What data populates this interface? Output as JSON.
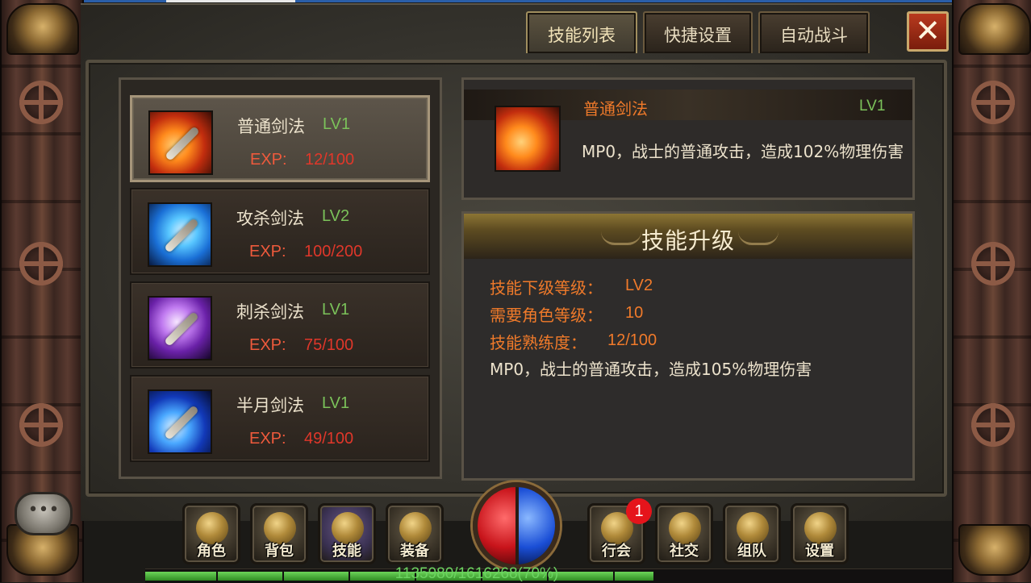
{
  "tabs": [
    {
      "label": "技能列表",
      "active": true
    },
    {
      "label": "快捷设置",
      "active": false
    },
    {
      "label": "自动战斗",
      "active": false
    }
  ],
  "close_label": "✕",
  "skills": [
    {
      "name": "普通剑法",
      "level": "LV1",
      "exp_label": "EXP:",
      "exp": "12/100",
      "icon": "fire-blade-icon"
    },
    {
      "name": "攻杀剑法",
      "level": "LV2",
      "exp_label": "EXP:",
      "exp": "100/200",
      "icon": "ice-sword-icon"
    },
    {
      "name": "刺杀剑法",
      "level": "LV1",
      "exp_label": "EXP:",
      "exp": "75/100",
      "icon": "violet-sword-icon"
    },
    {
      "name": "半月剑法",
      "level": "LV1",
      "exp_label": "EXP:",
      "exp": "49/100",
      "icon": "crescent-blade-icon"
    }
  ],
  "detail": {
    "name": "普通剑法",
    "level": "LV1",
    "description": "MP0，战士的普通攻击，造成102%物理伤害"
  },
  "upgrade": {
    "title": "技能升级",
    "rows": [
      {
        "label": "技能下级等级：",
        "value": "LV2"
      },
      {
        "label": "需要角色等级：",
        "value": "10"
      },
      {
        "label": "技能熟练度：",
        "value": "12/100"
      }
    ],
    "description": "MP0，战士的普通攻击，造成105%物理伤害"
  },
  "menu": {
    "left": [
      "角色",
      "背包",
      "技能",
      "装备"
    ],
    "right": [
      "行会",
      "社交",
      "组队",
      "设置"
    ],
    "guild_badge": "1"
  },
  "exp_bar": {
    "text": "1135980/1616268(70%)",
    "fraction": 0.7
  },
  "colors": {
    "accent_orange": "#f07a2a",
    "level_green": "#7bc25a",
    "exp_red": "#e0372a",
    "hp": "#c8141b",
    "mp": "#1a4ed6"
  }
}
